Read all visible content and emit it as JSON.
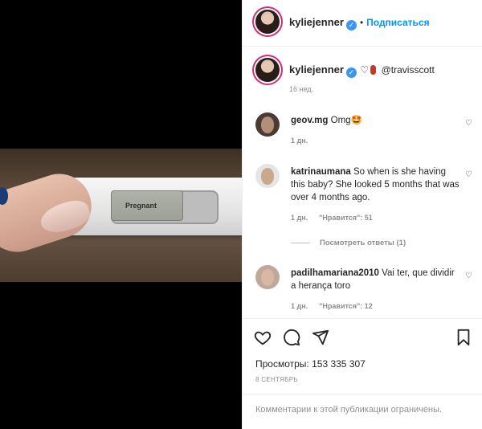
{
  "post": {
    "image_text": "Pregnant"
  },
  "header": {
    "username": "kyliejenner",
    "separator": "•",
    "follow_label": "Подписаться"
  },
  "caption": {
    "username": "kyliejenner",
    "mention": "@travisscott",
    "age": "16 нед."
  },
  "comments": [
    {
      "username": "geov.mg",
      "text": "Omg🤩",
      "age": "1 дн.",
      "likes": ""
    },
    {
      "username": "katrinaumana",
      "text": "So when is she having this baby? She looked 5 months that was over 4 months ago.",
      "age": "1 дн.",
      "likes": "\"Нравится\": 51"
    },
    {
      "username": "padilhamariana2010",
      "text": "Vai ter, que dividir a herança toro",
      "age": "1 дн.",
      "likes": "\"Нравится\": 12"
    }
  ],
  "replies_label": "Посмотреть ответы (1)",
  "views": "Просмотры: 153 335 307",
  "date": "8 СЕНТЯБРЬ",
  "footer": "Комментарии к этой публикации ограничены.",
  "colors": {
    "link": "#0095f6",
    "verified": "#3897f0",
    "muted": "#8e8e8e"
  }
}
